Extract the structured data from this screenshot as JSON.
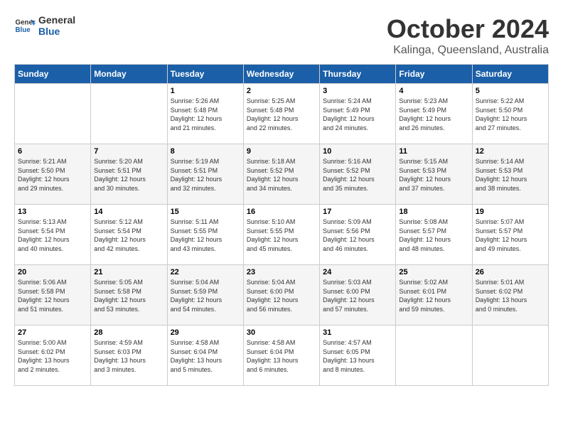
{
  "header": {
    "logo_line1": "General",
    "logo_line2": "Blue",
    "month_title": "October 2024",
    "subtitle": "Kalinga, Queensland, Australia"
  },
  "days_of_week": [
    "Sunday",
    "Monday",
    "Tuesday",
    "Wednesday",
    "Thursday",
    "Friday",
    "Saturday"
  ],
  "weeks": [
    [
      {
        "day": "",
        "info": ""
      },
      {
        "day": "",
        "info": ""
      },
      {
        "day": "1",
        "info": "Sunrise: 5:26 AM\nSunset: 5:48 PM\nDaylight: 12 hours\nand 21 minutes."
      },
      {
        "day": "2",
        "info": "Sunrise: 5:25 AM\nSunset: 5:48 PM\nDaylight: 12 hours\nand 22 minutes."
      },
      {
        "day": "3",
        "info": "Sunrise: 5:24 AM\nSunset: 5:49 PM\nDaylight: 12 hours\nand 24 minutes."
      },
      {
        "day": "4",
        "info": "Sunrise: 5:23 AM\nSunset: 5:49 PM\nDaylight: 12 hours\nand 26 minutes."
      },
      {
        "day": "5",
        "info": "Sunrise: 5:22 AM\nSunset: 5:50 PM\nDaylight: 12 hours\nand 27 minutes."
      }
    ],
    [
      {
        "day": "6",
        "info": "Sunrise: 5:21 AM\nSunset: 5:50 PM\nDaylight: 12 hours\nand 29 minutes."
      },
      {
        "day": "7",
        "info": "Sunrise: 5:20 AM\nSunset: 5:51 PM\nDaylight: 12 hours\nand 30 minutes."
      },
      {
        "day": "8",
        "info": "Sunrise: 5:19 AM\nSunset: 5:51 PM\nDaylight: 12 hours\nand 32 minutes."
      },
      {
        "day": "9",
        "info": "Sunrise: 5:18 AM\nSunset: 5:52 PM\nDaylight: 12 hours\nand 34 minutes."
      },
      {
        "day": "10",
        "info": "Sunrise: 5:16 AM\nSunset: 5:52 PM\nDaylight: 12 hours\nand 35 minutes."
      },
      {
        "day": "11",
        "info": "Sunrise: 5:15 AM\nSunset: 5:53 PM\nDaylight: 12 hours\nand 37 minutes."
      },
      {
        "day": "12",
        "info": "Sunrise: 5:14 AM\nSunset: 5:53 PM\nDaylight: 12 hours\nand 38 minutes."
      }
    ],
    [
      {
        "day": "13",
        "info": "Sunrise: 5:13 AM\nSunset: 5:54 PM\nDaylight: 12 hours\nand 40 minutes."
      },
      {
        "day": "14",
        "info": "Sunrise: 5:12 AM\nSunset: 5:54 PM\nDaylight: 12 hours\nand 42 minutes."
      },
      {
        "day": "15",
        "info": "Sunrise: 5:11 AM\nSunset: 5:55 PM\nDaylight: 12 hours\nand 43 minutes."
      },
      {
        "day": "16",
        "info": "Sunrise: 5:10 AM\nSunset: 5:55 PM\nDaylight: 12 hours\nand 45 minutes."
      },
      {
        "day": "17",
        "info": "Sunrise: 5:09 AM\nSunset: 5:56 PM\nDaylight: 12 hours\nand 46 minutes."
      },
      {
        "day": "18",
        "info": "Sunrise: 5:08 AM\nSunset: 5:57 PM\nDaylight: 12 hours\nand 48 minutes."
      },
      {
        "day": "19",
        "info": "Sunrise: 5:07 AM\nSunset: 5:57 PM\nDaylight: 12 hours\nand 49 minutes."
      }
    ],
    [
      {
        "day": "20",
        "info": "Sunrise: 5:06 AM\nSunset: 5:58 PM\nDaylight: 12 hours\nand 51 minutes."
      },
      {
        "day": "21",
        "info": "Sunrise: 5:05 AM\nSunset: 5:58 PM\nDaylight: 12 hours\nand 53 minutes."
      },
      {
        "day": "22",
        "info": "Sunrise: 5:04 AM\nSunset: 5:59 PM\nDaylight: 12 hours\nand 54 minutes."
      },
      {
        "day": "23",
        "info": "Sunrise: 5:04 AM\nSunset: 6:00 PM\nDaylight: 12 hours\nand 56 minutes."
      },
      {
        "day": "24",
        "info": "Sunrise: 5:03 AM\nSunset: 6:00 PM\nDaylight: 12 hours\nand 57 minutes."
      },
      {
        "day": "25",
        "info": "Sunrise: 5:02 AM\nSunset: 6:01 PM\nDaylight: 12 hours\nand 59 minutes."
      },
      {
        "day": "26",
        "info": "Sunrise: 5:01 AM\nSunset: 6:02 PM\nDaylight: 13 hours\nand 0 minutes."
      }
    ],
    [
      {
        "day": "27",
        "info": "Sunrise: 5:00 AM\nSunset: 6:02 PM\nDaylight: 13 hours\nand 2 minutes."
      },
      {
        "day": "28",
        "info": "Sunrise: 4:59 AM\nSunset: 6:03 PM\nDaylight: 13 hours\nand 3 minutes."
      },
      {
        "day": "29",
        "info": "Sunrise: 4:58 AM\nSunset: 6:04 PM\nDaylight: 13 hours\nand 5 minutes."
      },
      {
        "day": "30",
        "info": "Sunrise: 4:58 AM\nSunset: 6:04 PM\nDaylight: 13 hours\nand 6 minutes."
      },
      {
        "day": "31",
        "info": "Sunrise: 4:57 AM\nSunset: 6:05 PM\nDaylight: 13 hours\nand 8 minutes."
      },
      {
        "day": "",
        "info": ""
      },
      {
        "day": "",
        "info": ""
      }
    ]
  ]
}
